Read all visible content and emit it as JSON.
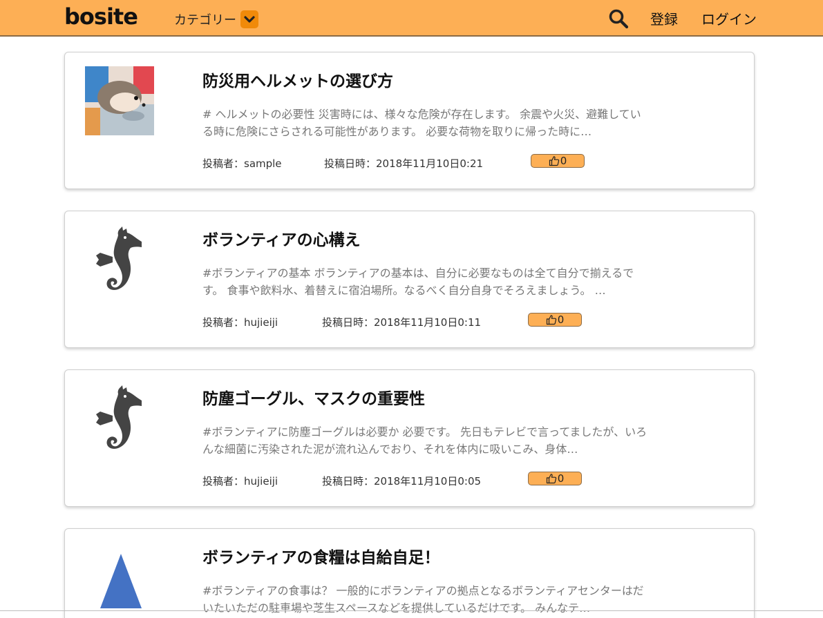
{
  "header": {
    "logo": "bosite",
    "category_label": "カテゴリー",
    "register_label": "登録",
    "login_label": "ログイン",
    "accent_color": "#fdaf55"
  },
  "posts": [
    {
      "title": "防災用ヘルメットの選び方",
      "excerpt": "# ヘルメットの必要性 災害時には、様々な危険が存在します。 余震や火災、避難している時に危険にさらされる可能性があります。 必要な荷物を取りに帰った時に…",
      "author": "投稿者：sample",
      "date": "投稿日時：2018年11月10日0:21",
      "likes": "0",
      "thumbnail": "hedgehog-photo"
    },
    {
      "title": "ボランティアの心構え",
      "excerpt": "#ボランティアの基本 ボランティアの基本は、自分に必要なものは全て自分で揃えるです。 食事や飲料水、着替えに宿泊場所。なるべく自分自身でそろえましょう。 …",
      "author": "投稿者：hujieiji",
      "date": "投稿日時：2018年11月10日0:11",
      "likes": "0",
      "thumbnail": "seahorse-icon"
    },
    {
      "title": "防塵ゴーグル、マスクの重要性",
      "excerpt": "#ボランティアに防塵ゴーグルは必要か 必要です。 先日もテレビで言ってましたが、いろんな細菌に汚染された泥が流れ込んでおり、それを体内に吸いこみ、身体…",
      "author": "投稿者：hujieiji",
      "date": "投稿日時：2018年11月10日0:05",
      "likes": "0",
      "thumbnail": "seahorse-icon"
    },
    {
      "title": "ボランティアの食糧は自給自足！",
      "excerpt": "#ボランティアの食事は？ 一般的にボランティアの拠点となるボランティアセンターはだいたいただの駐車場や芝生スペースなどを提供しているだけです。 みんなテ…",
      "author": "",
      "date": "",
      "likes": "",
      "thumbnail": "blue-triangle-icon"
    }
  ]
}
